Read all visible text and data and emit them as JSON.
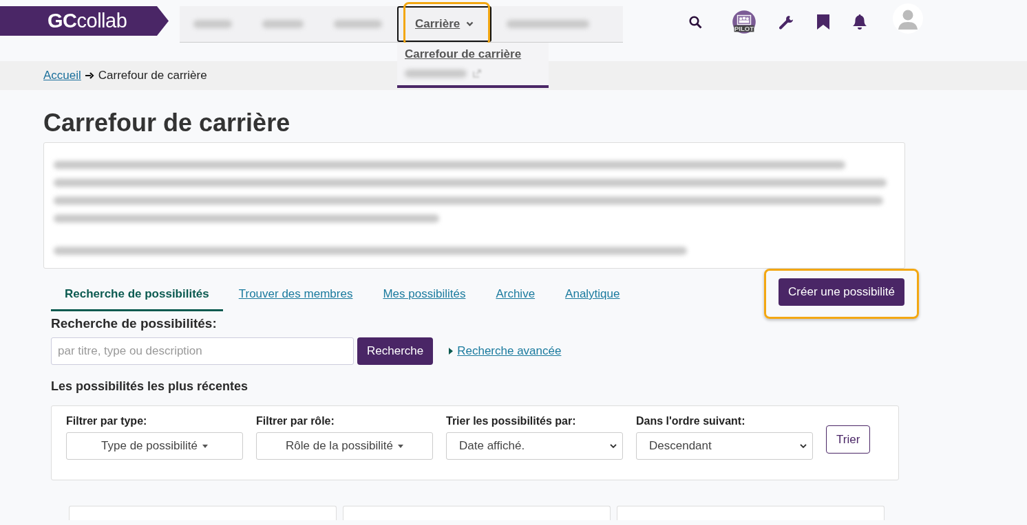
{
  "header": {
    "logo": "**GC**collab",
    "nav": [
      {
        "kind": "blurred"
      },
      {
        "kind": "blurred"
      },
      {
        "kind": "blurred"
      },
      {
        "kind": "menu",
        "label": "Carrière",
        "expanded": true,
        "highlighted": true
      },
      {
        "kind": "blurred"
      }
    ],
    "dropdown": [
      {
        "kind": "link",
        "label": "Carrefour de carrière"
      },
      {
        "kind": "blurred"
      }
    ],
    "pilot_badge": "PILOT"
  },
  "breadcrumb": [
    {
      "label": "Accueil",
      "link": true
    },
    {
      "label": "Carrefour de carrière",
      "link": false
    }
  ],
  "title": "Carrefour de carrière",
  "tabs": [
    {
      "label": "Recherche de possibilités",
      "selected": true
    },
    {
      "label": "Trouver des membres",
      "selected": false
    },
    {
      "label": "Mes possibilités",
      "selected": false
    },
    {
      "label": "Archive",
      "selected": false
    },
    {
      "label": "Analytique",
      "selected": false
    }
  ],
  "create_button": {
    "label": "Créer une possibilité",
    "highlighted": true
  },
  "search": {
    "label": "Recherche de possibilités:",
    "placeholder": "par titre, type ou description",
    "button": "Recherche",
    "advanced_link": "Recherche avancée"
  },
  "recent_heading": "Les possibilités les plus récentes",
  "filters": [
    {
      "label": "Filtrer par type:",
      "kind": "dropdown-button",
      "value": "Type de possibilité"
    },
    {
      "label": "Filtrer par rôle:",
      "kind": "dropdown-button",
      "value": "Rôle de la possibilité"
    },
    {
      "label": "Trier les possibilités par:",
      "kind": "select",
      "value": "Date affiché."
    },
    {
      "label": "Dans l'ordre suivant:",
      "kind": "select",
      "value": "Descendant"
    }
  ],
  "sort_button": "Trier"
}
